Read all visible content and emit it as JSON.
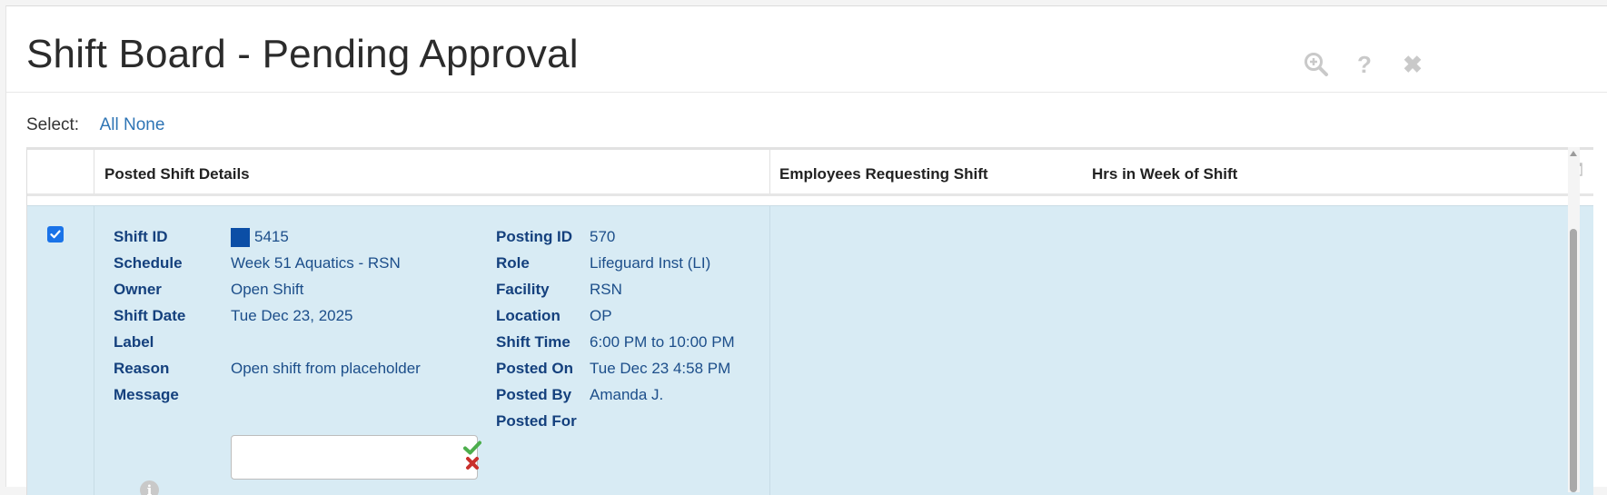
{
  "header": {
    "title": "Shift Board - Pending Approval",
    "icons": [
      "zoom-in-icon",
      "help-icon",
      "close-icon"
    ],
    "help_glyph": "?",
    "close_glyph": "✖"
  },
  "select": {
    "label": "Select:",
    "all": "All",
    "none": "None"
  },
  "table": {
    "columns": [
      "",
      "Posted Shift Details",
      "Employees Requesting Shift",
      "Hrs in Week of Shift"
    ],
    "rows": [
      {
        "checked": true,
        "left": [
          {
            "label": "Shift ID",
            "value": "5415"
          },
          {
            "label": "Schedule",
            "value": "Week 51 Aquatics - RSN"
          },
          {
            "label": "Owner",
            "value": "Open Shift"
          },
          {
            "label": "Shift Date",
            "value": "Tue Dec 23, 2025"
          },
          {
            "label": "Label",
            "value": ""
          },
          {
            "label": "Reason",
            "value": "Open shift from placeholder"
          },
          {
            "label": "Message",
            "value": ""
          }
        ],
        "right": [
          {
            "label": "Posting ID",
            "value": "570"
          },
          {
            "label": "Role",
            "value": "Lifeguard Inst (LI)"
          },
          {
            "label": "Facility",
            "value": "RSN"
          },
          {
            "label": "Location",
            "value": "OP"
          },
          {
            "label": "Shift Time",
            "value": "6:00 PM to 10:00 PM"
          },
          {
            "label": "Posted On",
            "value": "Tue Dec 23 4:58 PM"
          },
          {
            "label": "Posted By",
            "value": "Amanda J."
          },
          {
            "label": "Posted For",
            "value": ""
          }
        ],
        "shift_color": "#0b4ea6",
        "info_glyph": "i"
      }
    ]
  },
  "colors": {
    "row_highlight": "#d8ebf4",
    "label_text": "#14407d",
    "link": "#2f75b5",
    "approve": "#4cae4c",
    "reject": "#c9302c"
  }
}
